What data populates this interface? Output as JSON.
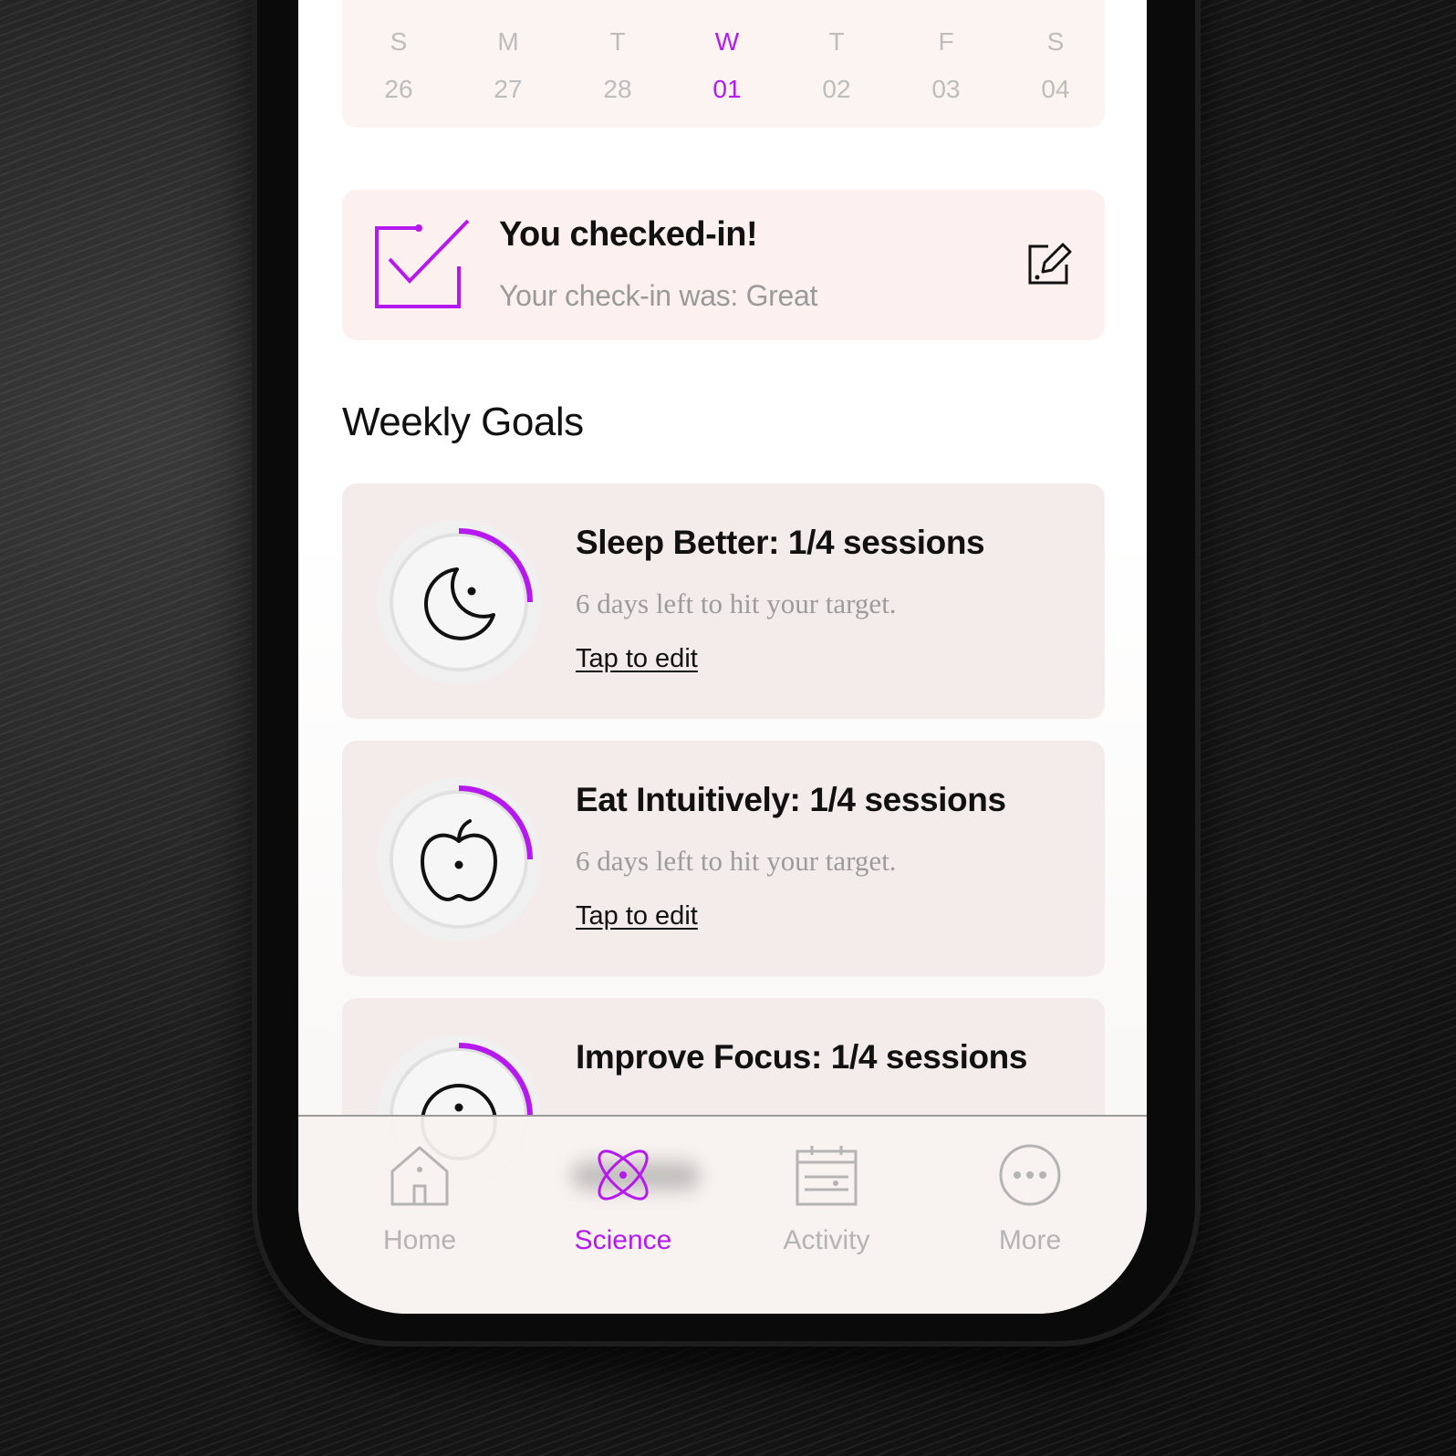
{
  "calendar": {
    "days": [
      {
        "letter": "S",
        "num": "26"
      },
      {
        "letter": "M",
        "num": "27"
      },
      {
        "letter": "T",
        "num": "28"
      },
      {
        "letter": "W",
        "num": "01"
      },
      {
        "letter": "T",
        "num": "02"
      },
      {
        "letter": "F",
        "num": "03"
      },
      {
        "letter": "S",
        "num": "04"
      }
    ],
    "active_index": 3
  },
  "checkin": {
    "title": "You checked-in!",
    "subtitle": "Your check-in was: Great",
    "icon": "checkbox-checked-icon",
    "edit_icon": "edit-pencil-icon"
  },
  "weekly_goals": {
    "title": "Weekly Goals",
    "goals": [
      {
        "title": "Sleep Better: 1/4 sessions",
        "subtitle": "6 days left to hit your target.",
        "link": "Tap to edit",
        "icon": "moon-icon",
        "progress": 0.25
      },
      {
        "title": "Eat Intuitively: 1/4 sessions",
        "subtitle": "6 days left to hit your target.",
        "link": "Tap to edit",
        "icon": "apple-icon",
        "progress": 0.25
      },
      {
        "title": "Improve Focus: 1/4 sessions",
        "subtitle": "",
        "link": "",
        "icon": "focus-icon",
        "progress": 0.25
      }
    ]
  },
  "tabbar": {
    "tabs": [
      {
        "label": "Home",
        "icon": "home-icon"
      },
      {
        "label": "Science",
        "icon": "atom-icon"
      },
      {
        "label": "Activity",
        "icon": "calendar-icon"
      },
      {
        "label": "More",
        "icon": "more-dots-icon"
      }
    ],
    "active_index": 1
  },
  "colors": {
    "accent": "#b519f0",
    "card": "#f3ecea",
    "checkin_card": "#fcf1ee"
  }
}
